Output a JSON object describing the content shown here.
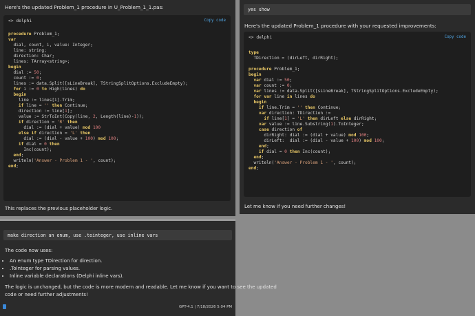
{
  "left": {
    "intro": "Here's the updated Problem_1 procedure in U_Problem_1_1.pas:",
    "code_lang": "<> delphi",
    "copy_label": "Copy code",
    "footer": "This replaces the previous placeholder logic."
  },
  "right": {
    "prompt": "yes show",
    "intro": "Here's the updated Problem_1 procedure with your requested improvements:",
    "code_lang": "<> delphi",
    "copy_label": "Copy code",
    "footer": "Let me know if you need further changes!"
  },
  "bottom": {
    "prompt": "make direction an enum, use .tointeger, use inline vars",
    "uses_line": "The code now uses:",
    "bullets": [
      "An enum type TDirection for direction.",
      ".ToInteger for parsing values.",
      "Inline variable declarations (Delphi inline vars)."
    ],
    "summary_line1": "The logic is unchanged, but the code is more modern and readable. Let me know if you want to see the updated",
    "summary_line2": "code or need further adjustments!",
    "model_info": "GPT-4.1 | 7/18/2026 5:04 PM"
  },
  "colors": {
    "panel": "#2b2b2b",
    "code_bg": "#1e1e1e",
    "keyword": "#e8c766",
    "string": "#d8a07a",
    "number": "#e08080",
    "link": "#4fa3e0"
  }
}
